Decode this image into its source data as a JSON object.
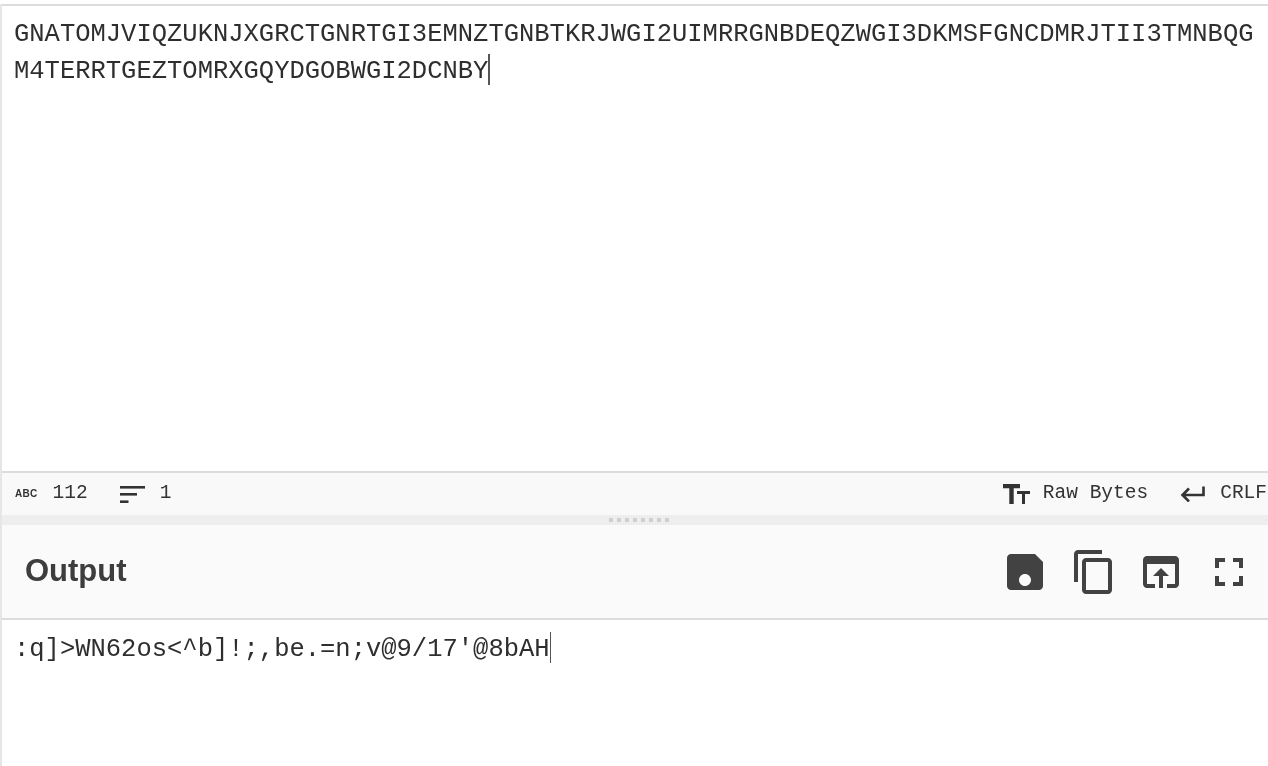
{
  "input": {
    "text": "GNATOMJVIQZUKNJXGRCTGNRTGI3EMNZTGNBTKRJWGI2UIMRRGNBDEQZWGI3DKMSFGNCDMRJTII3TMNBQGM4TERRTGEZTOMRXGQYDGOBWGI2DCNBY"
  },
  "status_bar": {
    "length_label": "ABC",
    "length": "112",
    "lines": "1",
    "encoding": "Raw Bytes",
    "line_ending": "CRLF"
  },
  "output": {
    "title": "Output",
    "text": ":q]>WN62os<^b]!;,be.=n;v@9/17'@8bAH"
  }
}
